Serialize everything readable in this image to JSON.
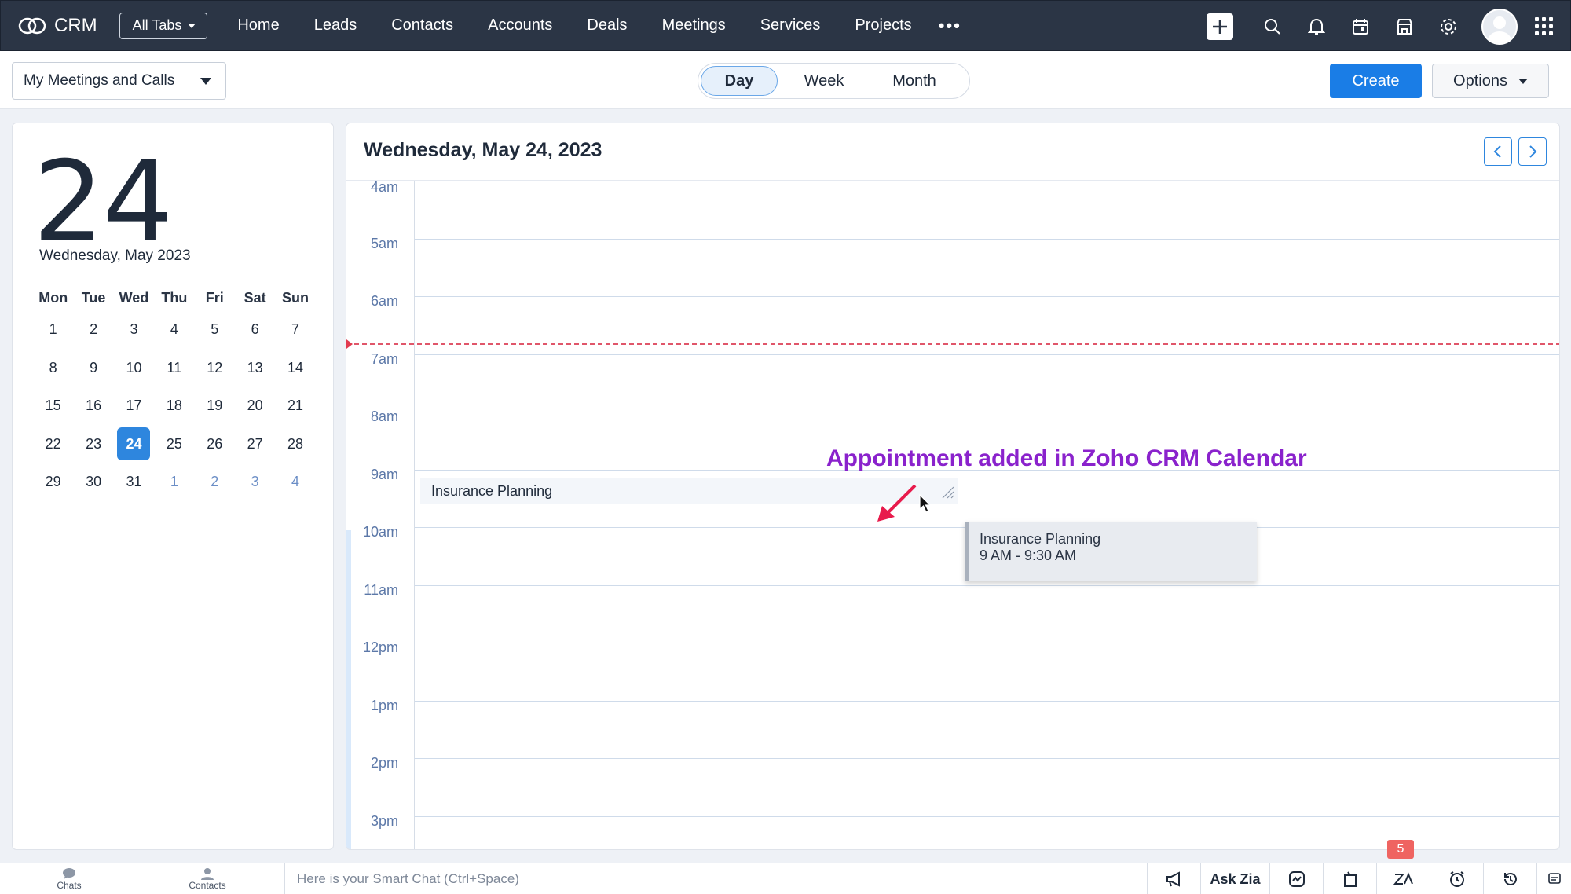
{
  "app": {
    "name": "CRM"
  },
  "topnav": {
    "all_tabs": "All Tabs",
    "links": [
      "Home",
      "Leads",
      "Contacts",
      "Accounts",
      "Deals",
      "Meetings",
      "Services",
      "Projects"
    ],
    "more": "•••"
  },
  "subbar": {
    "view_select": "My Meetings and Calls",
    "segments": [
      "Day",
      "Week",
      "Month"
    ],
    "active_segment": "Day",
    "create_label": "Create",
    "options_label": "Options"
  },
  "mini_calendar": {
    "big_day": "24",
    "month_label": "Wednesday, May 2023",
    "weekdays": [
      "Mon",
      "Tue",
      "Wed",
      "Thu",
      "Fri",
      "Sat",
      "Sun"
    ],
    "weeks": [
      [
        "1",
        "2",
        "3",
        "4",
        "5",
        "6",
        "7"
      ],
      [
        "8",
        "9",
        "10",
        "11",
        "12",
        "13",
        "14"
      ],
      [
        "15",
        "16",
        "17",
        "18",
        "19",
        "20",
        "21"
      ],
      [
        "22",
        "23",
        "24",
        "25",
        "26",
        "27",
        "28"
      ],
      [
        "29",
        "30",
        "31",
        "1",
        "2",
        "3",
        "4"
      ]
    ],
    "selected": "24"
  },
  "day_view": {
    "title": "Wednesday, May 24, 2023",
    "hours": [
      "4am",
      "5am",
      "6am",
      "7am",
      "8am",
      "9am",
      "10am",
      "11am",
      "12pm",
      "1pm",
      "2pm",
      "3pm"
    ],
    "event": {
      "title": "Insurance Planning"
    },
    "tooltip": {
      "title": "Insurance Planning",
      "time": "9 AM - 9:30 AM"
    },
    "annotation": "Appointment added in Zoho CRM Calendar"
  },
  "bottombar": {
    "chats": "Chats",
    "contacts": "Contacts",
    "smart_chat_placeholder": "Here is your Smart Chat (Ctrl+Space)",
    "ask_zia": "Ask Zia",
    "notification_count": "5"
  },
  "colors": {
    "accent": "#1a7de6",
    "nav_bg": "#2b3545",
    "annotation": "#8a22cc",
    "now_line": "#e0566a"
  }
}
